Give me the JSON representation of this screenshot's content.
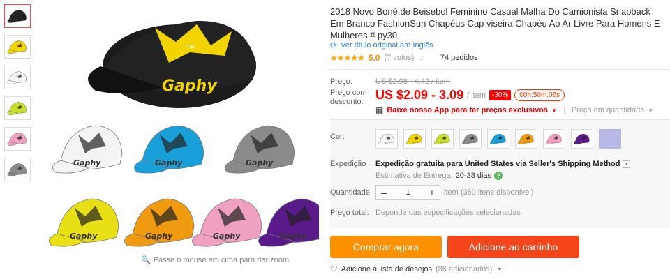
{
  "gallery": {
    "thumb_colors": [
      "#222222",
      "#f2d400",
      "#f4f4f4",
      "#c9e02a",
      "#f0a0c0",
      "#8a8a8a"
    ],
    "main_color": "#f2d400",
    "grid_colors": [
      "#f4f4f4",
      "#1aa0d8",
      "#8a8a8a",
      "#e8e014",
      "#f09a10",
      "#f0a0c0",
      "#5a1a8a"
    ],
    "zoom_hint": "Passe o mouse em cima para dar zoom"
  },
  "product": {
    "title": "2018 Novo Boné de Beisebol Feminino Casual Malha Do Camionista Snapback Em Branco FashionSun Chapéus Cap viseira Chapéu Ao Ar Livre Para Homens E Mulheres # py30",
    "translate_link": "Ver título original em Inglês",
    "rating_stars": "★★★★★",
    "rating_value": "5.0",
    "votes": "(7 votos)",
    "orders": "74 pedidos"
  },
  "price": {
    "label": "Preço:",
    "old": "US $2.98 - 4.42 / item",
    "discount_label": "Preço com desconto:",
    "new": "US $2.09 - 3.09",
    "per": "/ item",
    "discount_badge": "-30%",
    "timer": "00h:50m:06s"
  },
  "promo": {
    "app_text": "Baixe nosso App para ter preços exclusivos",
    "qty_price": "Preço em quantidade"
  },
  "options": {
    "color_label": "Cor:",
    "swatch_colors": [
      "#f4f4f4",
      "#f2d400",
      "#c9e02a",
      "#8a8a8a",
      "#1aa0d8",
      "#f09a10",
      "#f0a0c0",
      "#5a1a8a"
    ],
    "plain_swatch_color": "#b8b8e6",
    "shipping_label": "Expedição",
    "shipping_main": "Expedição gratuita para United States via Seller's Shipping Method",
    "shipping_est_label": "Estimativa de Entrega:",
    "shipping_days": "20-38 dias",
    "quantity_label": "Quantidade",
    "quantity_value": "1",
    "quantity_avail": "item (350 itens disponível)",
    "total_label": "Preço total:",
    "total_value": "Depende das especificações selecionadas"
  },
  "actions": {
    "buy": "Comprar agora",
    "cart": "Adicione ao carrinho",
    "wishlist": "Adicione a lista de desejos",
    "wishlist_count": "(86 adicionados)"
  },
  "colors": {
    "accent_red": "#f00",
    "buy_orange": "#ff9100",
    "cart_red": "#f5451a",
    "link_blue": "#2d7de0",
    "star": "#ffa200"
  }
}
